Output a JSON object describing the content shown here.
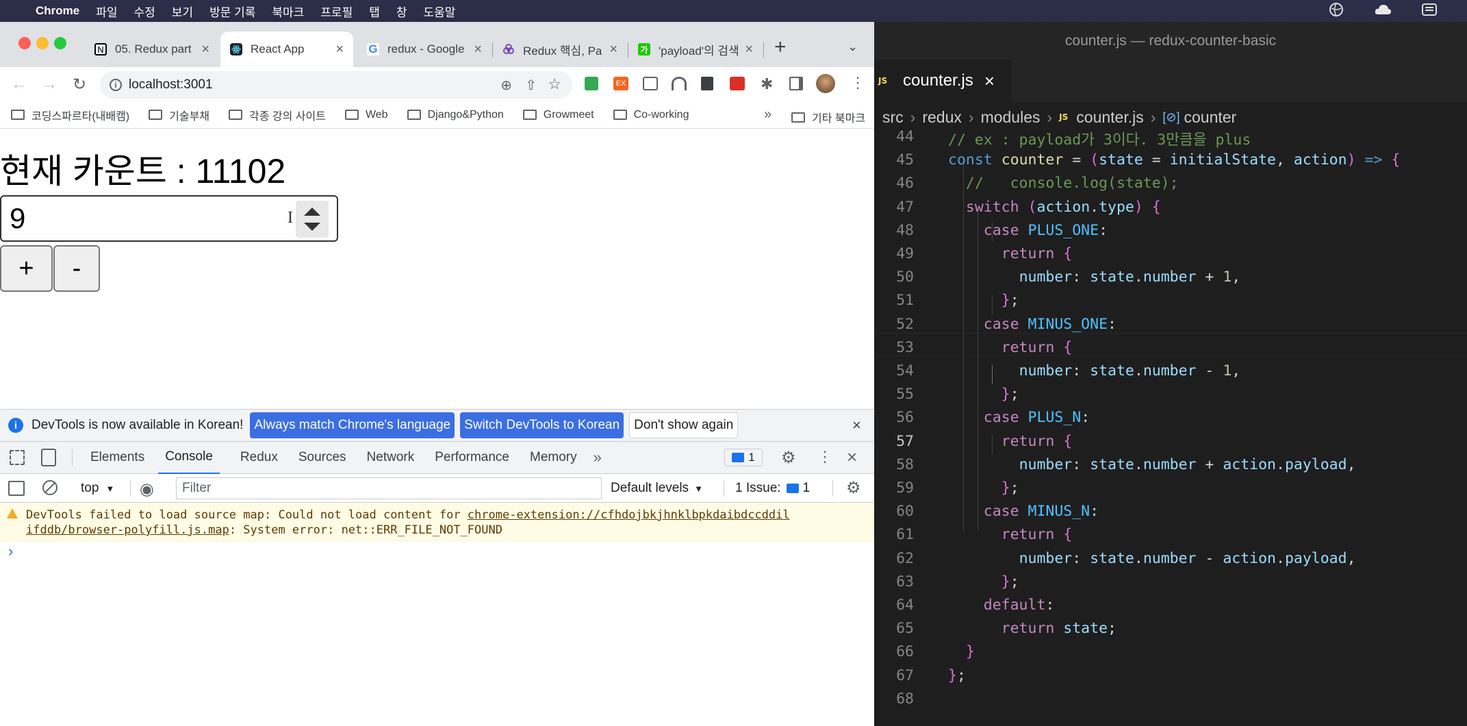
{
  "menubar": {
    "app": "Chrome",
    "items": [
      "파일",
      "수정",
      "보기",
      "방문 기록",
      "북마크",
      "프로필",
      "탭",
      "창",
      "도움말"
    ]
  },
  "chrome": {
    "tabs": [
      {
        "title": "05. Redux part",
        "favicon_color": "#000000"
      },
      {
        "title": "React App",
        "favicon_color": "#20232a"
      },
      {
        "title": "redux - Google",
        "favicon_color": "#4285f4"
      },
      {
        "title": "Redux 핵심, Par",
        "favicon_color": "#764abc"
      },
      {
        "title": "'payload'의 검색",
        "favicon_color": "#1ec800"
      }
    ],
    "new_tab": "+",
    "url": "localhost:3001",
    "bookmarks": [
      "코딩스파르타(내배캠)",
      "기술부채",
      "각종 강의 사이트",
      "Web",
      "Django&Python",
      "Growmeet",
      "Co-working"
    ],
    "other_bookmarks": "기타 북마크",
    "more": "»"
  },
  "page": {
    "heading": "현재 카운트 : 11102",
    "input_value": "9",
    "plus_label": "+",
    "minus_label": "-"
  },
  "devtools": {
    "info_text": "DevTools is now available in Korean!",
    "btn_match": "Always match Chrome's language",
    "btn_switch": "Switch DevTools to Korean",
    "btn_dont": "Don't show again",
    "tabs": [
      "Elements",
      "Console",
      "Redux",
      "Sources",
      "Network",
      "Performance",
      "Memory"
    ],
    "selected_tab": "Console",
    "badge_count": "1",
    "context": "top",
    "filter_placeholder": "Filter",
    "levels": "Default levels",
    "issues": "1 Issue:",
    "issues_count": "1",
    "warning_line1_prefix": "DevTools failed to load source map: Could not load content for ",
    "warning_link1": "chrome-extension://cfhdojbkjhnklbpkdaibdccddil",
    "warning_link2": "ifddb/browser-polyfill.js.map",
    "warning_line2_suffix": ": System error: net::ERR_FILE_NOT_FOUND",
    "prompt": "›"
  },
  "vscode": {
    "title": "counter.js — redux-counter-basic",
    "tab_name": "counter.js",
    "breadcrumb": [
      "src",
      "redux",
      "modules",
      "counter.js",
      "counter"
    ],
    "lines": [
      {
        "n": "44",
        "t": "// ex : payload가 3이다. 3만큼을 plus"
      },
      {
        "n": "45",
        "t": "const counter = (state = initialState, action) => {"
      },
      {
        "n": "46",
        "t": "  //   console.log(state);"
      },
      {
        "n": "47",
        "t": "  switch (action.type) {"
      },
      {
        "n": "48",
        "t": "    case PLUS_ONE:"
      },
      {
        "n": "49",
        "t": "      return {"
      },
      {
        "n": "50",
        "t": "        number: state.number + 1,"
      },
      {
        "n": "51",
        "t": "      };"
      },
      {
        "n": "52",
        "t": "    case MINUS_ONE:"
      },
      {
        "n": "53",
        "t": "      return {"
      },
      {
        "n": "54",
        "t": "        number: state.number - 1,"
      },
      {
        "n": "55",
        "t": "      };"
      },
      {
        "n": "56",
        "t": "    case PLUS_N:"
      },
      {
        "n": "57",
        "t": "      return {"
      },
      {
        "n": "58",
        "t": "        number: state.number + action.payload,"
      },
      {
        "n": "59",
        "t": "      };"
      },
      {
        "n": "60",
        "t": "    case MINUS_N:"
      },
      {
        "n": "61",
        "t": "      return {"
      },
      {
        "n": "62",
        "t": "        number: state.number - action.payload,"
      },
      {
        "n": "63",
        "t": "      };"
      },
      {
        "n": "64",
        "t": "    default:"
      },
      {
        "n": "65",
        "t": "      return state;"
      },
      {
        "n": "66",
        "t": "  }"
      },
      {
        "n": "67",
        "t": "};"
      },
      {
        "n": "68",
        "t": ""
      }
    ],
    "current_line": "57"
  }
}
